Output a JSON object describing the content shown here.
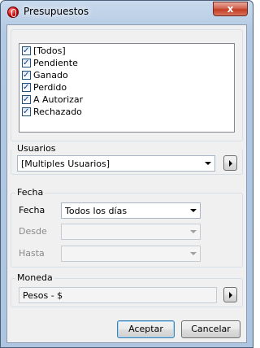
{
  "window": {
    "title": "Presupuestos",
    "close_glyph": "x"
  },
  "states": {
    "items": [
      {
        "label": "[Todos]",
        "checked": true
      },
      {
        "label": "Pendiente",
        "checked": true
      },
      {
        "label": "Ganado",
        "checked": true
      },
      {
        "label": "Perdido",
        "checked": true
      },
      {
        "label": "A Autorizar",
        "checked": true
      },
      {
        "label": "Rechazado",
        "checked": true
      }
    ]
  },
  "usuarios": {
    "group_label": "Usuarios",
    "value": "[Multiples Usuarios]"
  },
  "fecha": {
    "group_label": "Fecha",
    "fecha_label": "Fecha",
    "fecha_value": "Todos los días",
    "desde_label": "Desde",
    "desde_value": "",
    "hasta_label": "Hasta",
    "hasta_value": ""
  },
  "moneda": {
    "group_label": "Moneda",
    "value": "Pesos - $"
  },
  "buttons": {
    "accept": "Aceptar",
    "cancel": "Cancelar"
  }
}
